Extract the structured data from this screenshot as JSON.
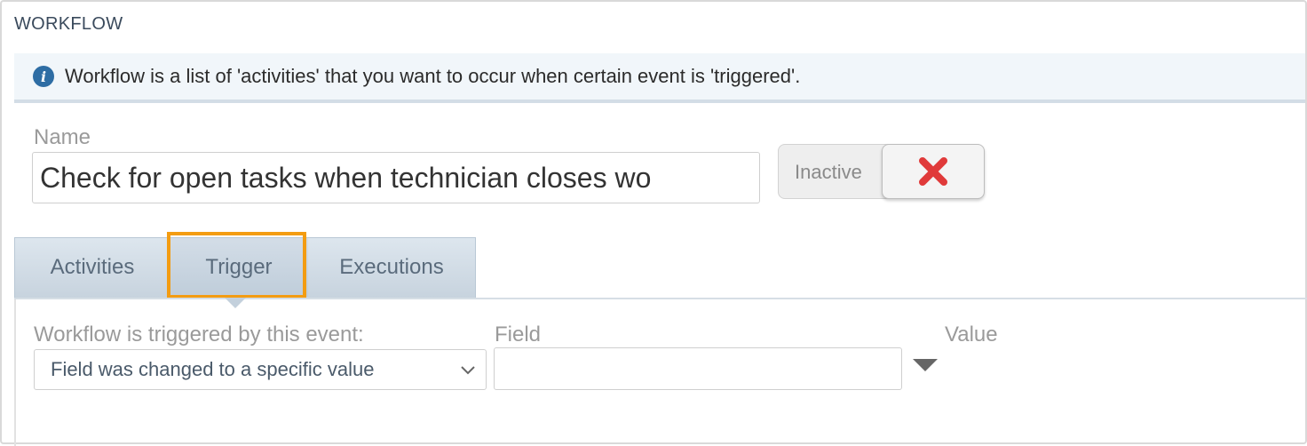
{
  "section": {
    "title": "WORKFLOW"
  },
  "info": {
    "icon": "info-icon",
    "text": "Workflow is a list of 'activities' that you want to occur when certain event is 'triggered'."
  },
  "name": {
    "label": "Name",
    "value": "Check for open tasks when technician closes wo"
  },
  "status_toggle": {
    "label": "Inactive",
    "icon": "close-icon",
    "icon_color": "#e03a3a"
  },
  "tabs": [
    {
      "label": "Activities"
    },
    {
      "label": "Trigger",
      "active": true
    },
    {
      "label": "Executions"
    }
  ],
  "trigger": {
    "event_label": "Workflow is triggered by this event:",
    "event_value": "Field was changed to a specific value",
    "field_label": "Field",
    "field_value": "",
    "value_label": "Value"
  },
  "colors": {
    "highlight": "#f39c12",
    "info_icon": "#2e6da4"
  }
}
